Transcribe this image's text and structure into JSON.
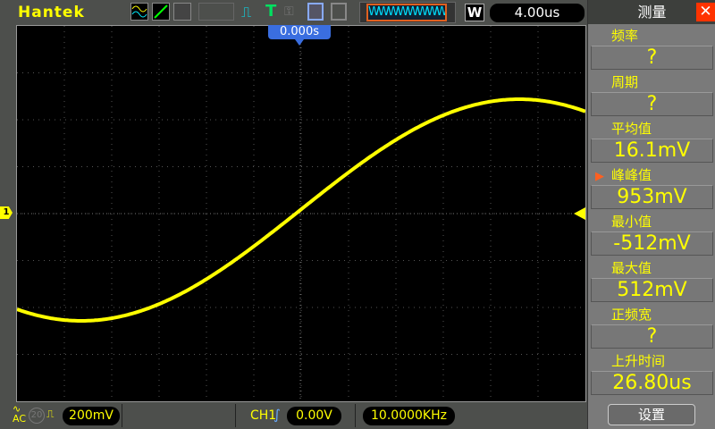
{
  "header": {
    "brand": "Hantek",
    "trigger_type": "T",
    "waveform_strip": "WWWWWWWWWW",
    "w_label": "W",
    "timebase": "4.00us",
    "trigger_position": "0.000s"
  },
  "channel": {
    "marker": "1",
    "coupling": "AC",
    "bw_limit": "20",
    "volts_div": "200mV"
  },
  "trigger": {
    "source": "CH1",
    "level": "0.00V",
    "frequency": "10.0000KHz"
  },
  "panel": {
    "title": "测量",
    "close": "✕",
    "settings_label": "设置",
    "items": [
      {
        "label": "频率",
        "value": "?"
      },
      {
        "label": "周期",
        "value": "?"
      },
      {
        "label": "平均值",
        "value": "16.1mV"
      },
      {
        "label": "峰峰值",
        "value": "953mV"
      },
      {
        "label": "最小值",
        "value": "-512mV"
      },
      {
        "label": "最大值",
        "value": "512mV"
      },
      {
        "label": "正频宽",
        "value": "?"
      },
      {
        "label": "上升时间",
        "value": "26.80us"
      }
    ],
    "selected_index": 3
  },
  "colors": {
    "trace": "#ffff00",
    "accent": "#e06020",
    "trigger_marker": "#3a6ee0"
  }
}
